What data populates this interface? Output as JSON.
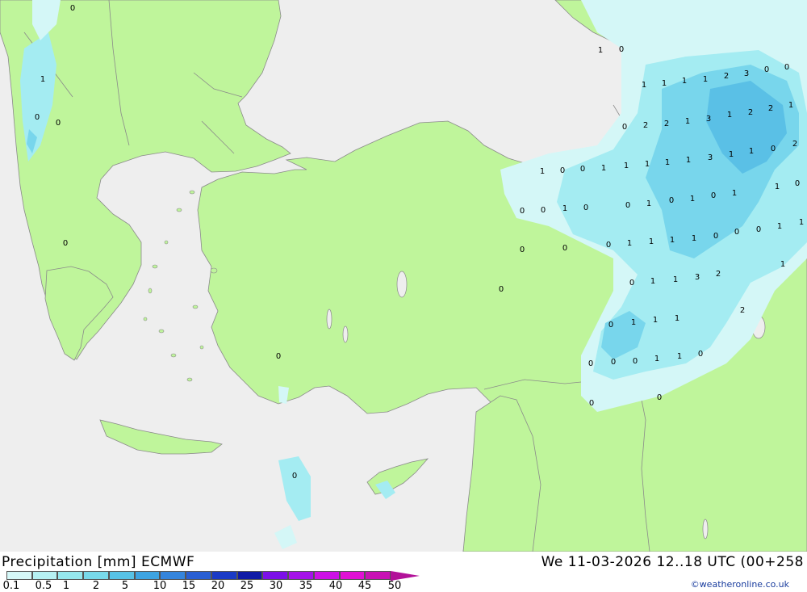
{
  "colors": {
    "sea": "#eeeeee",
    "land": "#bff59b",
    "border": "#8a8a8a",
    "precip_light": "#d4f7f7",
    "precip_mid": "#a4ecf2",
    "precip_high": "#78d6ec",
    "precip_max": "#5ac0e6"
  },
  "map_values": [
    "0",
    "1",
    "0",
    "0",
    "1",
    "0",
    "1",
    "1",
    "1",
    "1",
    "2",
    "3",
    "0",
    "0",
    "0",
    "2",
    "2",
    "1",
    "3",
    "1",
    "2",
    "2",
    "1",
    "1",
    "0",
    "0",
    "1",
    "1",
    "1",
    "1",
    "1",
    "3",
    "1",
    "1",
    "0",
    "2",
    "0",
    "0",
    "1",
    "0",
    "0",
    "1",
    "0",
    "1",
    "0",
    "1",
    "1",
    "0",
    "0",
    "0",
    "0",
    "1",
    "1",
    "1",
    "1",
    "0",
    "0",
    "0",
    "1",
    "1",
    "1",
    "0",
    "0",
    "0",
    "1",
    "1",
    "3",
    "2",
    "2",
    "0",
    "1",
    "1",
    "1",
    "0",
    "0",
    "0",
    "1",
    "1",
    "0",
    "0",
    "0",
    "0",
    "0",
    "0"
  ],
  "legend": {
    "title": "Precipitation [mm] ECMWF",
    "valid": "We 11-03-2026 12..18 UTC (00+258",
    "credit": "©weatheronline.co.uk",
    "colors": [
      "#d6f8f8",
      "#b6f1f3",
      "#96e8ee",
      "#78d9ea",
      "#58c2e6",
      "#3ea4e2",
      "#3585dd",
      "#2a5fd3",
      "#1b3bc6",
      "#0f1aa6",
      "#7c10e8",
      "#a512e9",
      "#cd10e6",
      "#e010d4",
      "#c811b5",
      "#b21199"
    ],
    "ticks": [
      "0.1",
      "0.5",
      "1",
      "2",
      "5",
      "10",
      "15",
      "20",
      "25",
      "30",
      "35",
      "40",
      "45",
      "50"
    ]
  }
}
